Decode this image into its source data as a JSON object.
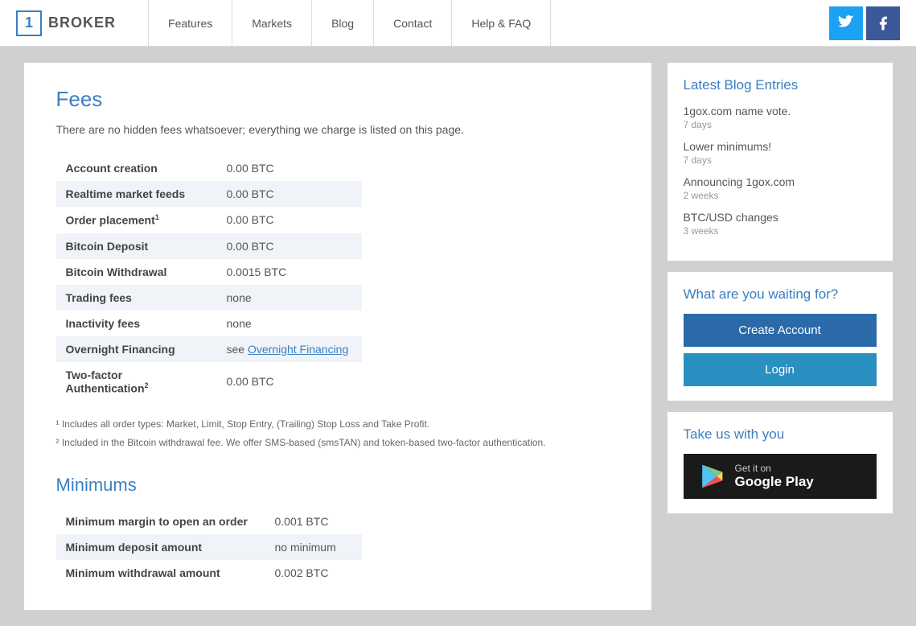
{
  "header": {
    "logo_number": "1",
    "logo_text": "BROKER",
    "nav_items": [
      {
        "id": "features",
        "label": "Features"
      },
      {
        "id": "markets",
        "label": "Markets"
      },
      {
        "id": "blog",
        "label": "Blog"
      },
      {
        "id": "contact",
        "label": "Contact"
      },
      {
        "id": "help",
        "label": "Help & FAQ"
      }
    ],
    "twitter_icon": "🐦",
    "facebook_icon": "f"
  },
  "main": {
    "fees_title": "Fees",
    "fees_subtitle": "There are no hidden fees whatsoever; everything we charge is listed on this page.",
    "fees_table": [
      {
        "label": "Account creation",
        "value": "0.00 BTC",
        "superscript": ""
      },
      {
        "label": "Realtime market feeds",
        "value": "0.00 BTC",
        "superscript": ""
      },
      {
        "label": "Order placement",
        "value": "0.00 BTC",
        "superscript": "1"
      },
      {
        "label": "Bitcoin Deposit",
        "value": "0.00 BTC",
        "superscript": ""
      },
      {
        "label": "Bitcoin Withdrawal",
        "value": "0.0015 BTC",
        "superscript": ""
      },
      {
        "label": "Trading fees",
        "value": "none",
        "superscript": ""
      },
      {
        "label": "Inactivity fees",
        "value": "none",
        "superscript": ""
      },
      {
        "label": "Overnight Financing",
        "value": "see Overnight Financing",
        "superscript": "",
        "link": true
      },
      {
        "label": "Two-factor Authentication",
        "value": "0.00 BTC",
        "superscript": "2"
      }
    ],
    "footnote1": "¹ Includes all order types: Market, Limit, Stop Entry, (Trailing) Stop Loss and Take Profit.",
    "footnote2": "² Included in the Bitcoin withdrawal fee. We offer SMS-based (smsTAN) and token-based two-factor authentication.",
    "minimums_title": "Minimums",
    "minimums_table": [
      {
        "label": "Minimum margin to open an order",
        "value": "0.001 BTC"
      },
      {
        "label": "Minimum deposit amount",
        "value": "no minimum"
      },
      {
        "label": "Minimum withdrawal amount",
        "value": "0.002 BTC"
      }
    ]
  },
  "sidebar": {
    "blog_title": "Latest Blog Entries",
    "blog_entries": [
      {
        "title": "1gox.com name vote.",
        "time": "7 days"
      },
      {
        "title": "Lower minimums!",
        "time": "7 days"
      },
      {
        "title": "Announcing 1gox.com",
        "time": "2 weeks"
      },
      {
        "title": "BTC/USD changes",
        "time": "3 weeks"
      }
    ],
    "cta_title": "What are you waiting for?",
    "create_account_label": "Create Account",
    "login_label": "Login",
    "take_us_title": "Take us with you",
    "google_play_get": "Get it on",
    "google_play_store": "Google Play"
  }
}
